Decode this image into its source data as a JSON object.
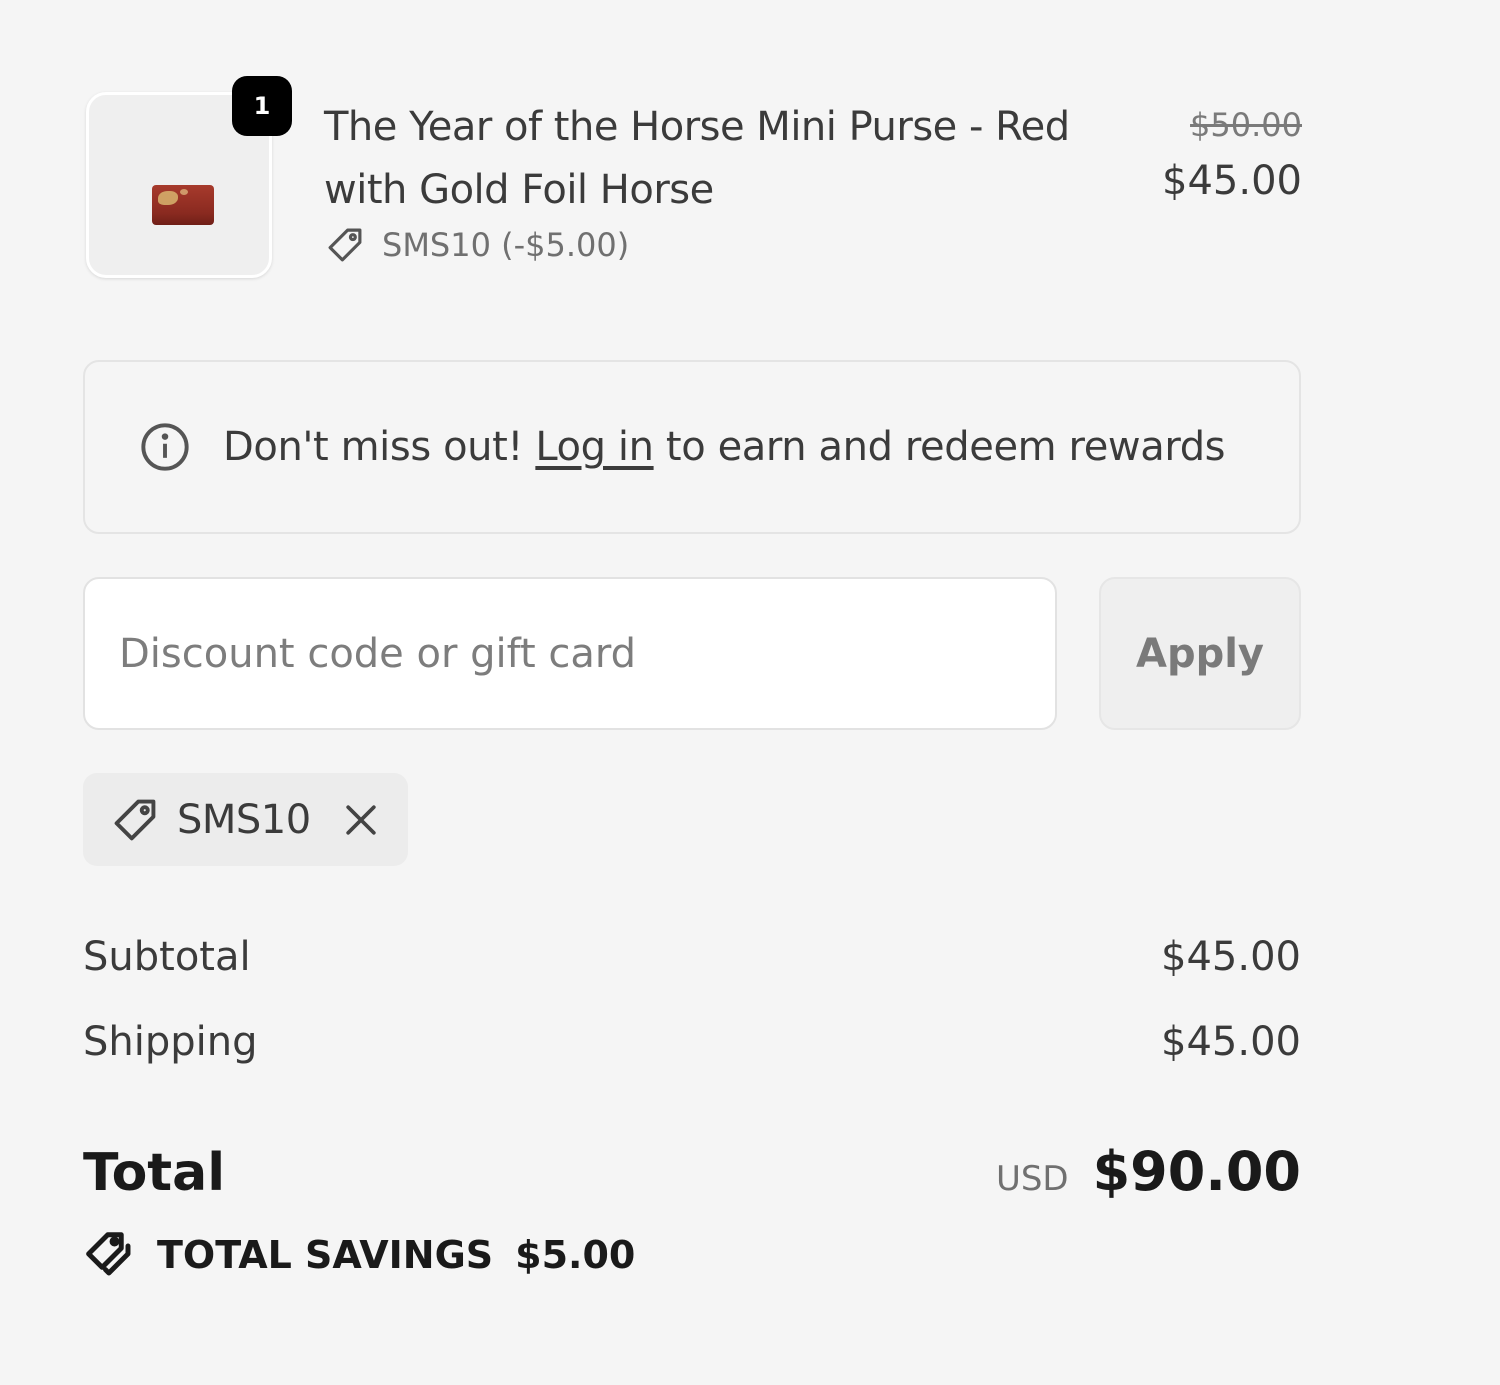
{
  "line_item": {
    "quantity": "1",
    "title": "The Year of the Horse Mini Purse - Red with Gold Foil Horse",
    "discount_text": "SMS10 (-$5.00)",
    "original_price": "$50.00",
    "final_price": "$45.00",
    "image_icon": "purse-thumbnail",
    "image_color": "#9a3126"
  },
  "rewards": {
    "icon": "info-icon",
    "text_before": "Don't miss out! ",
    "link_label": "Log in",
    "text_after": " to earn and redeem rewards"
  },
  "discount_form": {
    "placeholder": "Discount code or gift card",
    "value": "",
    "apply_label": "Apply"
  },
  "applied_code": {
    "icon": "tag-icon",
    "code": "SMS10",
    "remove_icon": "close-icon"
  },
  "summary": {
    "subtotal_label": "Subtotal",
    "subtotal_value": "$45.00",
    "shipping_label": "Shipping",
    "shipping_value": "$45.00",
    "total_label": "Total",
    "currency": "USD",
    "total_value": "$90.00",
    "savings_icon": "tags-icon",
    "savings_label": "TOTAL SAVINGS",
    "savings_value": "$5.00"
  },
  "colors": {
    "background": "#f5f5f5",
    "text": "#3b3b3b",
    "muted": "#707070",
    "badge": "#000000"
  }
}
